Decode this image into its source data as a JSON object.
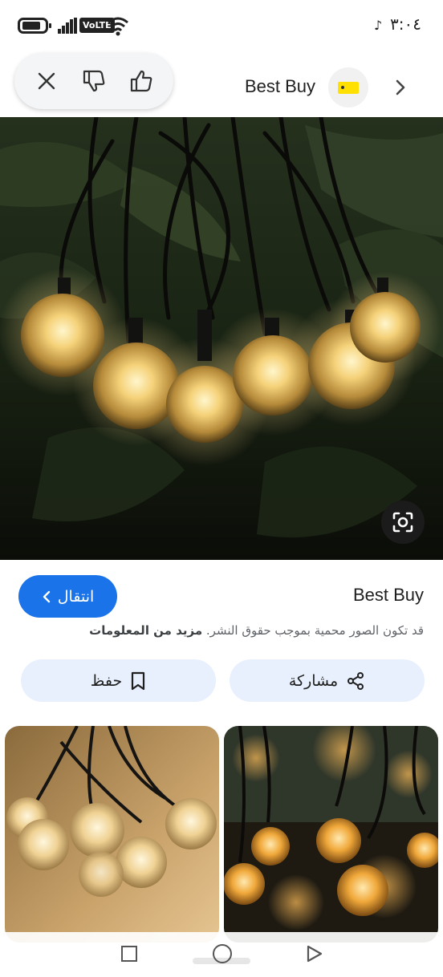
{
  "status_bar": {
    "time": "٣:٠٤",
    "volte": "VoLTE"
  },
  "header": {
    "source_name": "Best Buy",
    "feedback": {
      "close_icon": "close-icon",
      "dislike_icon": "thumb-down-icon",
      "like_icon": "thumb-up-icon"
    },
    "favicon": "tag-icon",
    "chevron": "chevron-right-icon"
  },
  "main_image": {
    "subject": "string lights",
    "lens_icon": "google-lens-icon"
  },
  "info": {
    "source_name": "Best Buy",
    "visit_label": "انتقال",
    "copyright_text": "قد تكون الصور محمية بموجب حقوق النشر.",
    "more_info_link": "مزيد من المعلومات"
  },
  "actions": {
    "share_label": "مشاركة",
    "save_label": "حفظ"
  },
  "colors": {
    "accent": "#1a73e8",
    "action_bg": "#e8f0fe",
    "brand_tag": "#ffe000"
  }
}
